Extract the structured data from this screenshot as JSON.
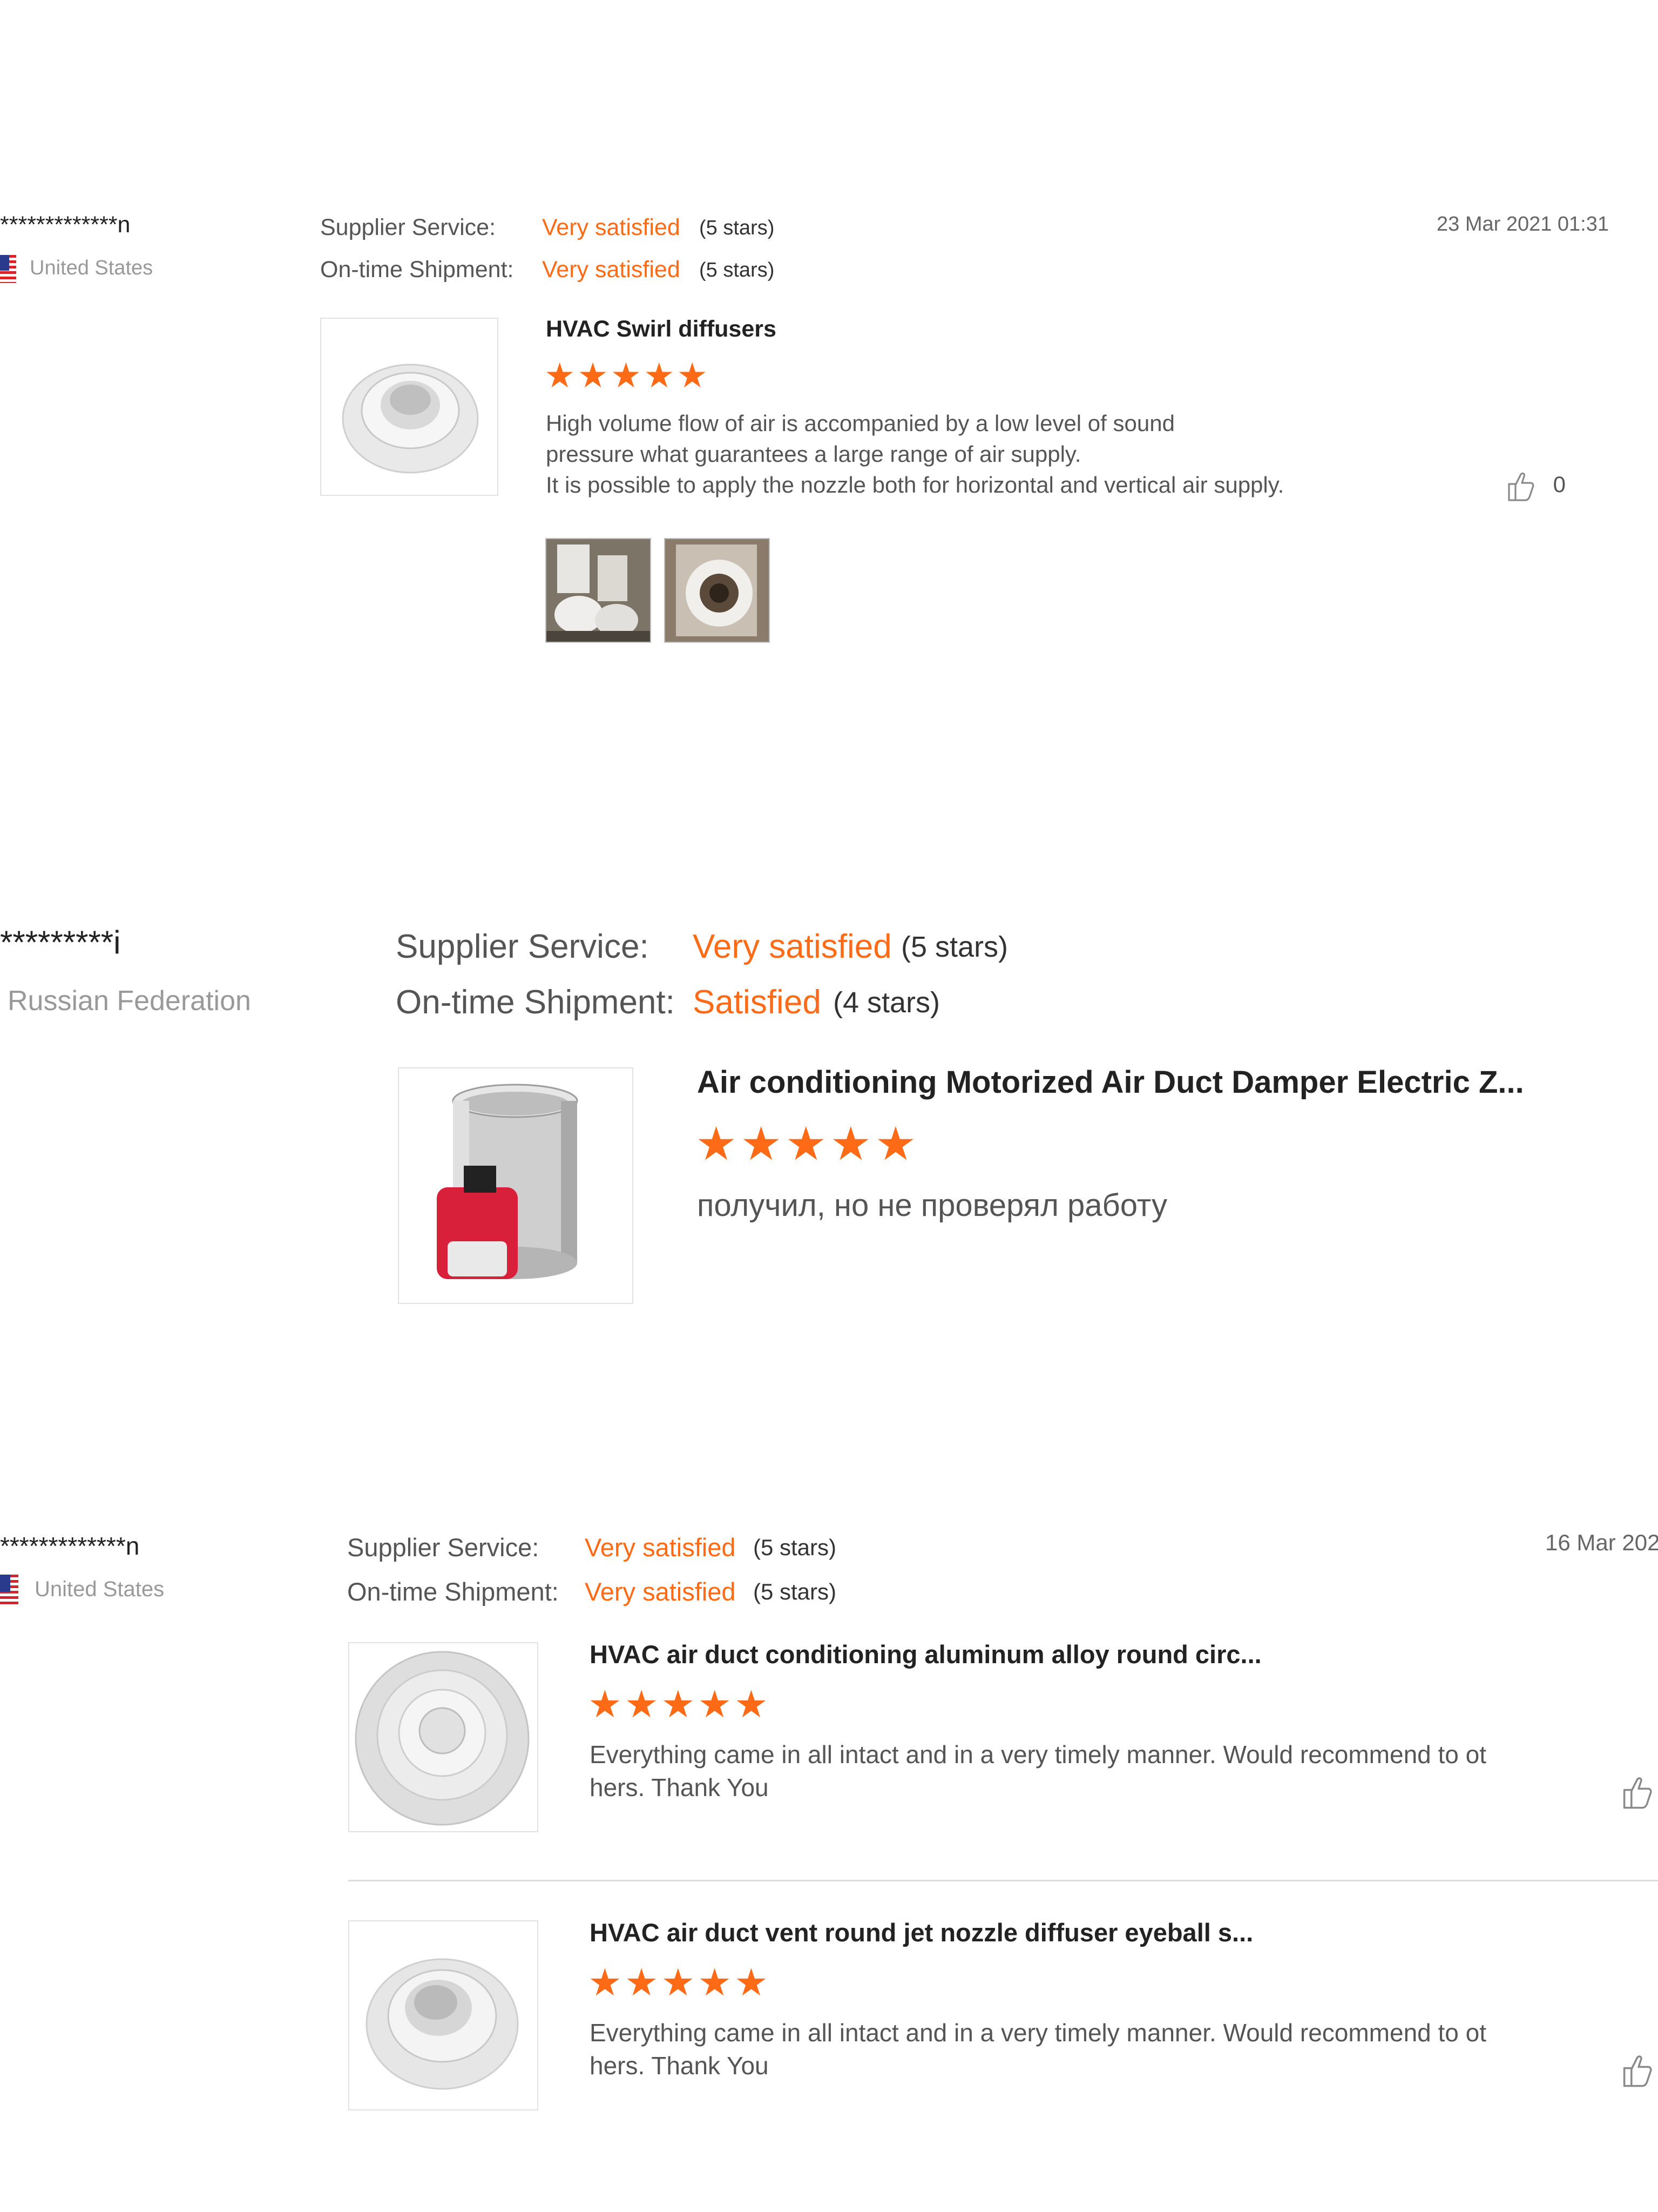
{
  "reviews": [
    {
      "username": "*************n",
      "country": "United States",
      "supplier_service_label": "Supplier Service:",
      "supplier_service_value": "Very satisfied",
      "supplier_service_stars": "(5 stars)",
      "shipment_label": "On-time Shipment:",
      "shipment_value": "Very satisfied",
      "shipment_stars": "(5 stars)",
      "date": "23 Mar 2021 01:31",
      "items": [
        {
          "product_title": "HVAC Swirl diffusers",
          "rating": "★★★★★",
          "text_lines": [
            "High volume flow of air is accompanied by a low level of sound",
            "pressure what guarantees a large range of air supply.",
            "It is possible to apply the nozzle both for horizontal and vertical air supply."
          ],
          "likes": "0"
        }
      ]
    },
    {
      "username": "*********i",
      "country": "Russian Federation",
      "supplier_service_label": "Supplier Service:",
      "supplier_service_value": "Very satisfied",
      "supplier_service_stars": "(5 stars)",
      "shipment_label": "On-time Shipment:",
      "shipment_value": "Satisfied",
      "shipment_stars": "(4 stars)",
      "items": [
        {
          "product_title": "Air conditioning Motorized Air Duct Damper Electric Z...",
          "rating": "★★★★★",
          "text": "получил, но не проверял работу"
        }
      ]
    },
    {
      "username": "*************n",
      "country": "United States",
      "supplier_service_label": "Supplier Service:",
      "supplier_service_value": "Very satisfied",
      "supplier_service_stars": "(5 stars)",
      "shipment_label": "On-time Shipment:",
      "shipment_value": "Very satisfied",
      "shipment_stars": "(5 stars)",
      "date": "16 Mar 202",
      "items": [
        {
          "product_title": "HVAC air duct conditioning aluminum alloy round circ...",
          "rating": "★★★★★",
          "text_lines": [
            "Everything came in all intact and in a very timely manner. Would recommend to ot",
            "hers. Thank You"
          ]
        },
        {
          "product_title": "HVAC air duct vent round jet nozzle diffuser eyeball s...",
          "rating": "★★★★★",
          "text_lines": [
            "Everything came in all intact and in a very timely manner. Would recommend to ot",
            "hers. Thank You"
          ]
        }
      ]
    }
  ],
  "colors": {
    "accent": "#ff6a16",
    "muted": "#999999",
    "border": "#e2e2e2"
  },
  "icons": [
    "us-flag-icon",
    "thumbs-up-icon"
  ]
}
